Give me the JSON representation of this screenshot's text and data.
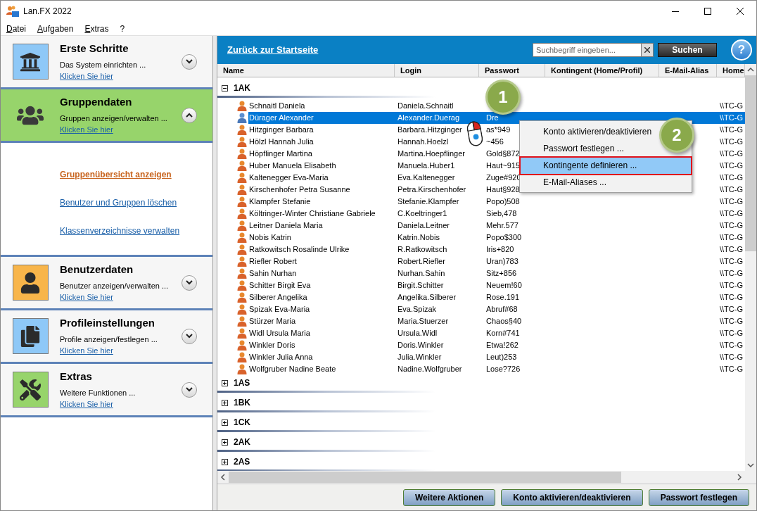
{
  "window": {
    "title": "Lan.FX 2022"
  },
  "menu": [
    {
      "label": "Datei",
      "mnemonic": true
    },
    {
      "label": "Aufgaben",
      "mnemonic": true
    },
    {
      "label": "Extras",
      "mnemonic": true
    },
    {
      "label": "?",
      "mnemonic": false
    }
  ],
  "sidebar": {
    "sections": [
      {
        "kind": "bank",
        "title": "Erste Schritte",
        "subtitle": "Das System einrichten ...",
        "link": "Klicken Sie hier",
        "expanded": false,
        "color": "#8ec8f7"
      },
      {
        "kind": "group",
        "title": "Gruppendaten",
        "subtitle": "Gruppen anzeigen/verwalten ...",
        "link": "Klicken Sie hier",
        "expanded": true,
        "color": "#97d46b",
        "links": [
          {
            "label": "Gruppenübersicht anzeigen",
            "selected": true
          },
          {
            "label": "Benutzer und Gruppen löschen",
            "selected": false
          },
          {
            "label": "Klassenverzeichnisse verwalten",
            "selected": false
          }
        ]
      },
      {
        "kind": "user",
        "title": "Benutzerdaten",
        "subtitle": "Benutzer anzeigen/verwalten ...",
        "link": "Klicken Sie hier",
        "expanded": false,
        "color": "#f8b54a"
      },
      {
        "kind": "documents",
        "title": "Profileinstellungen",
        "subtitle": "Profile anzeigen/festlegen ...",
        "link": "Klicken Sie hier",
        "expanded": false,
        "color": "#8ec8f7"
      },
      {
        "kind": "tools",
        "title": "Extras",
        "subtitle": "Weitere Funktionen ...",
        "link": "Klicken Sie hier",
        "expanded": false,
        "color": "#97d46b"
      }
    ]
  },
  "topbar": {
    "back_link": "Zurück zur Startseite",
    "search": {
      "placeholder": "Suchbegriff eingeben..."
    },
    "search_button": "Suchen",
    "help_button": "?"
  },
  "table": {
    "columns": [
      "Name",
      "Login",
      "Passwort",
      "Kontingent (Home/Profil)",
      "E-Mail-Alias",
      "Home"
    ],
    "groups": [
      {
        "label": "1AK",
        "expanded": true,
        "children": [
          {
            "name": "Schnaitl Daniela",
            "login": "Daniela.Schnaitl",
            "home": "\\\\TC-G",
            "selected": false
          },
          {
            "name": "Dürager Alexander",
            "login": "Alexander.Duerag",
            "password": "Dre",
            "home": "\\\\TC-G",
            "selected": true
          },
          {
            "name": "Hitzginger Barbara",
            "login": "Barbara.Hitzginger",
            "password": "as*949",
            "home": "\\\\TC-G",
            "selected": false
          },
          {
            "name": "Hölzl Hannah Julia",
            "login": "Hannah.Hoelzl",
            "password": "~456",
            "home": "\\\\TC-G",
            "selected": false
          },
          {
            "name": "Höpflinger Martina",
            "login": "Martina.Hoepflinger",
            "password": "Gold§872",
            "home": "\\\\TC-G",
            "selected": false
          },
          {
            "name": "Huber Manuela Elisabeth",
            "login": "Manuela.Huber1",
            "password": "Haut~915",
            "home": "\\\\TC-G",
            "selected": false
          },
          {
            "name": "Kaltenegger Eva-Maria",
            "login": "Eva.Kaltenegger",
            "password": "Zuge#920",
            "home": "\\\\TC-G",
            "selected": false
          },
          {
            "name": "Kirschenhofer Petra Susanne",
            "login": "Petra.Kirschenhofer",
            "password": "Haut§928",
            "home": "\\\\TC-G",
            "selected": false
          },
          {
            "name": "Klampfer Stefanie",
            "login": "Stefanie.Klampfer",
            "password": "Popo)508",
            "home": "\\\\TC-G",
            "selected": false
          },
          {
            "name": "Költringer-Winter Christiane Gabriele",
            "login": "C.Koeltringer1",
            "password": "Sieb,478",
            "home": "\\\\TC-G",
            "selected": false
          },
          {
            "name": "Leitner Daniela Maria",
            "login": "Daniela.Leitner",
            "password": "Mehr.577",
            "home": "\\\\TC-G",
            "selected": false
          },
          {
            "name": "Nobis Katrin",
            "login": "Katrin.Nobis",
            "password": "Popo$300",
            "home": "\\\\TC-G",
            "selected": false
          },
          {
            "name": "Ratkowitsch Rosalinde Ulrike",
            "login": "R.Ratkowitsch",
            "password": "Iris+820",
            "home": "\\\\TC-G",
            "selected": false
          },
          {
            "name": "Riefler Robert",
            "login": "Robert.Riefler",
            "password": "Uran)783",
            "home": "\\\\TC-G",
            "selected": false
          },
          {
            "name": "Sahin Nurhan",
            "login": "Nurhan.Sahin",
            "password": "Sitz+856",
            "home": "\\\\TC-G",
            "selected": false
          },
          {
            "name": "Schitter Birgit Eva",
            "login": "Birgit.Schitter",
            "password": "Neuem!60",
            "home": "\\\\TC-G",
            "selected": false
          },
          {
            "name": "Silberer Angelika",
            "login": "Angelika.Silberer",
            "password": "Rose.191",
            "home": "\\\\TC-G",
            "selected": false
          },
          {
            "name": "Spizak Eva-Maria",
            "login": "Eva.Spizak",
            "password": "Abruf#68",
            "home": "\\\\TC-G",
            "selected": false
          },
          {
            "name": "Stürzer Maria",
            "login": "Maria.Stuerzer",
            "password": "Chaos§40",
            "home": "\\\\TC-G",
            "selected": false
          },
          {
            "name": "Widl Ursula Maria",
            "login": "Ursula.Widl",
            "password": "Korn#741",
            "home": "\\\\TC-G",
            "selected": false
          },
          {
            "name": "Winkler Doris",
            "login": "Doris.Winkler",
            "password": "Etwa!262",
            "home": "\\\\TC-G",
            "selected": false
          },
          {
            "name": "Winkler Julia Anna",
            "login": "Julia.Winkler",
            "password": "Leut)253",
            "home": "\\\\TC-G",
            "selected": false
          },
          {
            "name": "Wolfgruber Nadine Beate",
            "login": "Nadine.Wolfgruber",
            "password": "Lose?726",
            "home": "\\\\TC-G",
            "selected": false
          }
        ]
      },
      {
        "label": "1AS",
        "expanded": false
      },
      {
        "label": "1BK",
        "expanded": false
      },
      {
        "label": "1CK",
        "expanded": false
      },
      {
        "label": "2AK",
        "expanded": false
      },
      {
        "label": "2AS",
        "expanded": false
      }
    ]
  },
  "context_menu": {
    "items": [
      {
        "label": "Konto aktivieren/deaktivieren",
        "selected": false
      },
      {
        "label": "Passwort festlegen ...",
        "selected": false
      },
      {
        "label": "Kontingente definieren ...",
        "selected": true
      },
      {
        "label": "E-Mail-Aliases ...",
        "selected": false
      }
    ]
  },
  "annotations": [
    "1",
    "2"
  ],
  "footer_buttons": [
    "Weitere Aktionen",
    "Konto aktivieren/deaktivieren",
    "Passwort festlegen"
  ]
}
